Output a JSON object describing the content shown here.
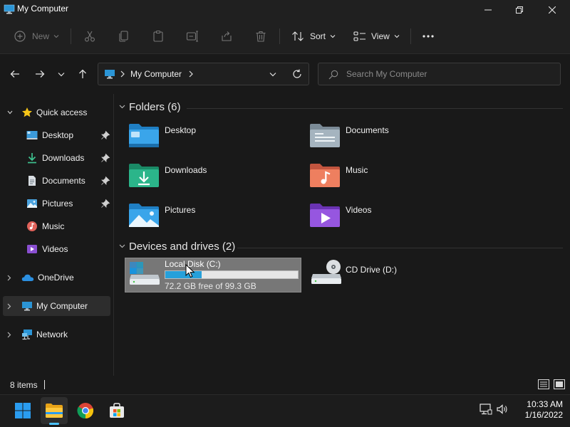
{
  "window": {
    "title": "My Computer"
  },
  "toolbar": {
    "new_label": "New",
    "sort_label": "Sort",
    "view_label": "View"
  },
  "address": {
    "path": [
      "My Computer"
    ],
    "search_placeholder": "Search My Computer"
  },
  "sidebar": {
    "quick_access": "Quick access",
    "items": [
      {
        "label": "Desktop",
        "pinned": true
      },
      {
        "label": "Downloads",
        "pinned": true
      },
      {
        "label": "Documents",
        "pinned": true
      },
      {
        "label": "Pictures",
        "pinned": true
      },
      {
        "label": "Music",
        "pinned": false
      },
      {
        "label": "Videos",
        "pinned": false
      }
    ],
    "onedrive": "OneDrive",
    "my_computer": "My Computer",
    "network": "Network"
  },
  "main": {
    "folders_header": "Folders (6)",
    "folders": [
      "Desktop",
      "Documents",
      "Downloads",
      "Music",
      "Pictures",
      "Videos"
    ],
    "drives_header": "Devices and drives (2)",
    "drives": [
      {
        "label": "Local Disk (C:)",
        "free_text": "72.2 GB free of 99.3 GB",
        "used_fraction": 0.273
      },
      {
        "label": "CD Drive (D:)"
      }
    ]
  },
  "status": {
    "items": "8 items"
  },
  "taskbar": {
    "time": "10:33 AM",
    "date": "1/16/2022"
  },
  "colors": {
    "accent": "#0078d4",
    "drive_bar": "#26a0da",
    "selection": "#777777"
  }
}
